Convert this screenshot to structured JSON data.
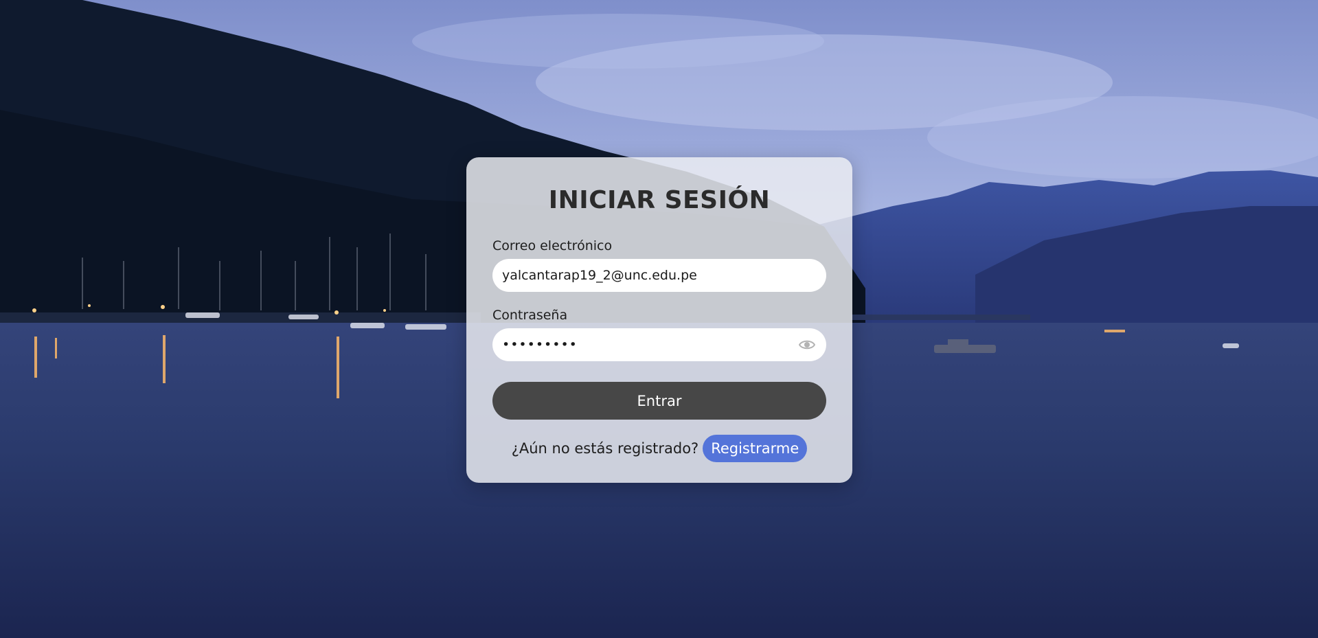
{
  "login": {
    "title": "INICIAR SESIÓN",
    "email_label": "Correo electrónico",
    "email_value": "yalcantarap19_2@unc.edu.pe",
    "password_label": "Contraseña",
    "password_value": "•••••••••",
    "submit_label": "Entrar",
    "register_prompt": "¿Aún no estás registrado?",
    "register_label": "Registrarme"
  },
  "icons": {
    "password_toggle": "eye-icon"
  },
  "colors": {
    "submit_button": "#474747",
    "register_button": "#5474d9",
    "title_text": "#2b2b2b"
  }
}
